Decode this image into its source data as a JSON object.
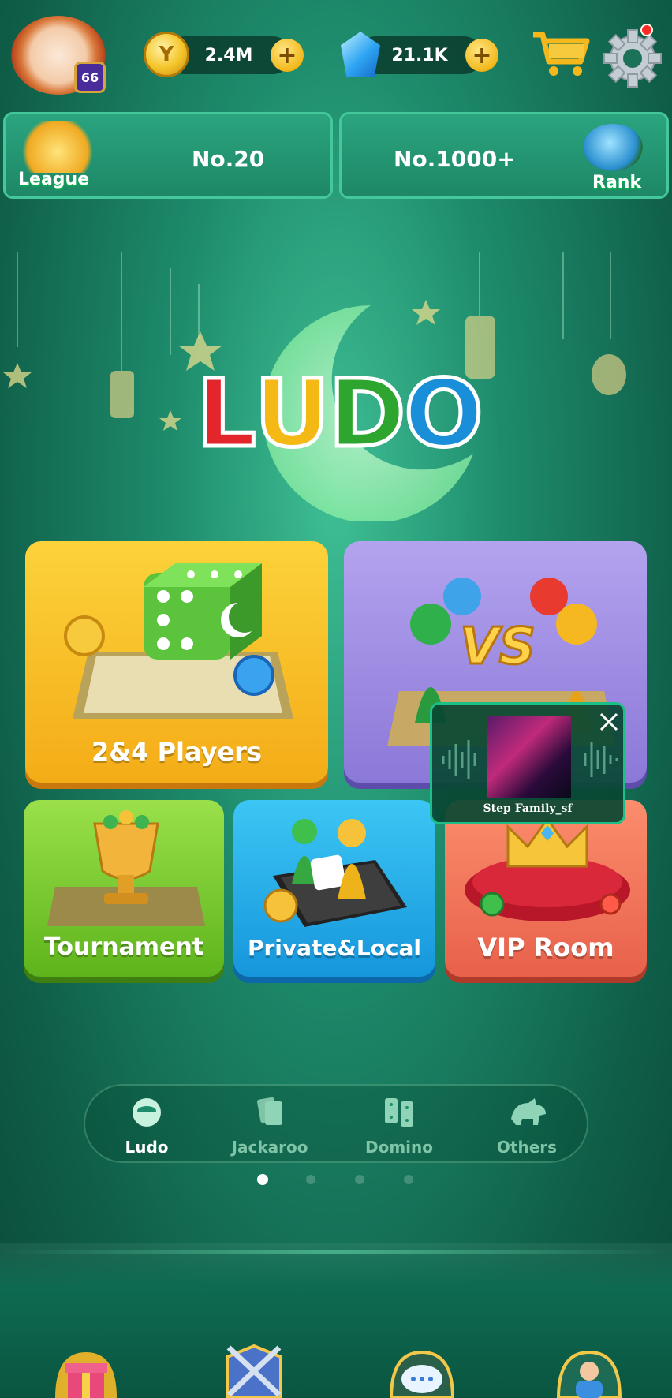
{
  "header": {
    "level": "66",
    "coins": "2.4M",
    "gems": "21.1K"
  },
  "ranking": {
    "league_label": "League",
    "league_position": "No.20",
    "rank_position": "No.1000+",
    "rank_label": "Rank"
  },
  "logo": {
    "letters": [
      "L",
      "U",
      "D",
      "O"
    ],
    "colors": [
      "#e3262c",
      "#f5b915",
      "#2ea52f",
      "#1a8fd9"
    ]
  },
  "modes": {
    "two_four_players": "2&4 Players",
    "tournament": "Tournament",
    "private_local": "Private&Local",
    "vip_room": "VIP Room"
  },
  "popup": {
    "caption": "Step Family_sf"
  },
  "game_tabs": [
    {
      "label": "Ludo",
      "active": true
    },
    {
      "label": "Jackaroo",
      "active": false
    },
    {
      "label": "Domino",
      "active": false
    },
    {
      "label": "Others",
      "active": false
    }
  ],
  "colors": {
    "accent_gold": "#f4c52a",
    "card_yellow": "#f6b51c",
    "card_purple": "#9c8be0",
    "card_green": "#7ccc2a",
    "card_blue": "#22a7e6",
    "card_coral": "#f57a5e"
  }
}
